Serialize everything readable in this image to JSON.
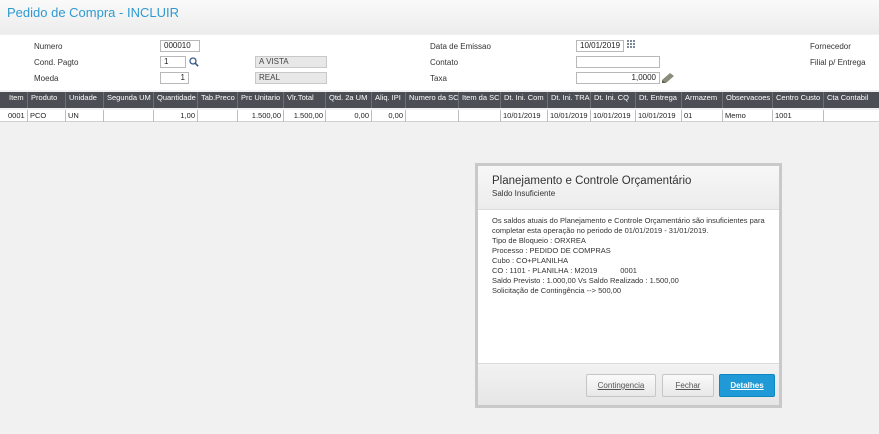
{
  "window": {
    "title": "Pedido de Compra - INCLUIR"
  },
  "form": {
    "numero": {
      "label": "Numero",
      "value": "000010"
    },
    "cond_pagto": {
      "label": "Cond. Pagto",
      "value": "1",
      "desc": "A VISTA"
    },
    "moeda": {
      "label": "Moeda",
      "value": "1",
      "desc": "REAL"
    },
    "data_emissao": {
      "label": "Data de Emissao",
      "value": "10/01/2019"
    },
    "contato": {
      "label": "Contato",
      "value": ""
    },
    "taxa": {
      "label": "Taxa",
      "value": "1,0000"
    },
    "fornecedor": {
      "label": "Fornecedor"
    },
    "filial_entrega": {
      "label": "Filial p/ Entrega"
    }
  },
  "grid": {
    "headers": [
      "Item",
      "Produto",
      "Unidade",
      "Segunda UM",
      "Quantidade",
      "Tab.Preco",
      "Prc Unitario",
      "Vlr.Total",
      "Qtd. 2a UM",
      "Aliq. IPI",
      "Numero da SC",
      "Item da SC",
      "Dt. Ini. Com",
      "Dt. Ini. TRA",
      "Dt. Ini. CQ",
      "Dt. Entrega",
      "Armazem",
      "Observacoes",
      "Centro Custo",
      "Cta Contabil"
    ],
    "rows": [
      [
        "0001",
        "PCO",
        "UN",
        "",
        "1,00",
        "",
        "1.500,00",
        "1.500,00",
        "0,00",
        "0,00",
        "",
        "",
        "10/01/2019",
        "10/01/2019",
        "10/01/2019",
        "10/01/2019",
        "01",
        "Memo",
        "1001",
        ""
      ]
    ]
  },
  "dialog": {
    "title": "Planejamento e Controle Orçamentário",
    "subtitle": "Saldo Insuficiente",
    "lines": [
      "Os saldos atuais do Planejamento e Controle Orçamentário são insuficientes para",
      "completar esta operação no periodo de 01/01/2019 - 31/01/2019.",
      "Tipo de Bloqueio : ORXREA",
      "Processo : PEDIDO DE COMPRAS",
      "Cubo : CO+PLANILHA",
      "CO : 1101 - PLANILHA : M2019           0001",
      "Saldo Previsto : 1.000,00 Vs Saldo Realizado : 1.500,00",
      "Solicitação de Contingência --> 500,00"
    ],
    "buttons": {
      "contingencia": "Contingencia",
      "fechar": "Fechar",
      "detalhes": "Detalhes"
    }
  },
  "colors": {
    "title": "#2e9ad1",
    "grid_header": "#4b4f55",
    "primary_button": "#1f9ad6"
  }
}
